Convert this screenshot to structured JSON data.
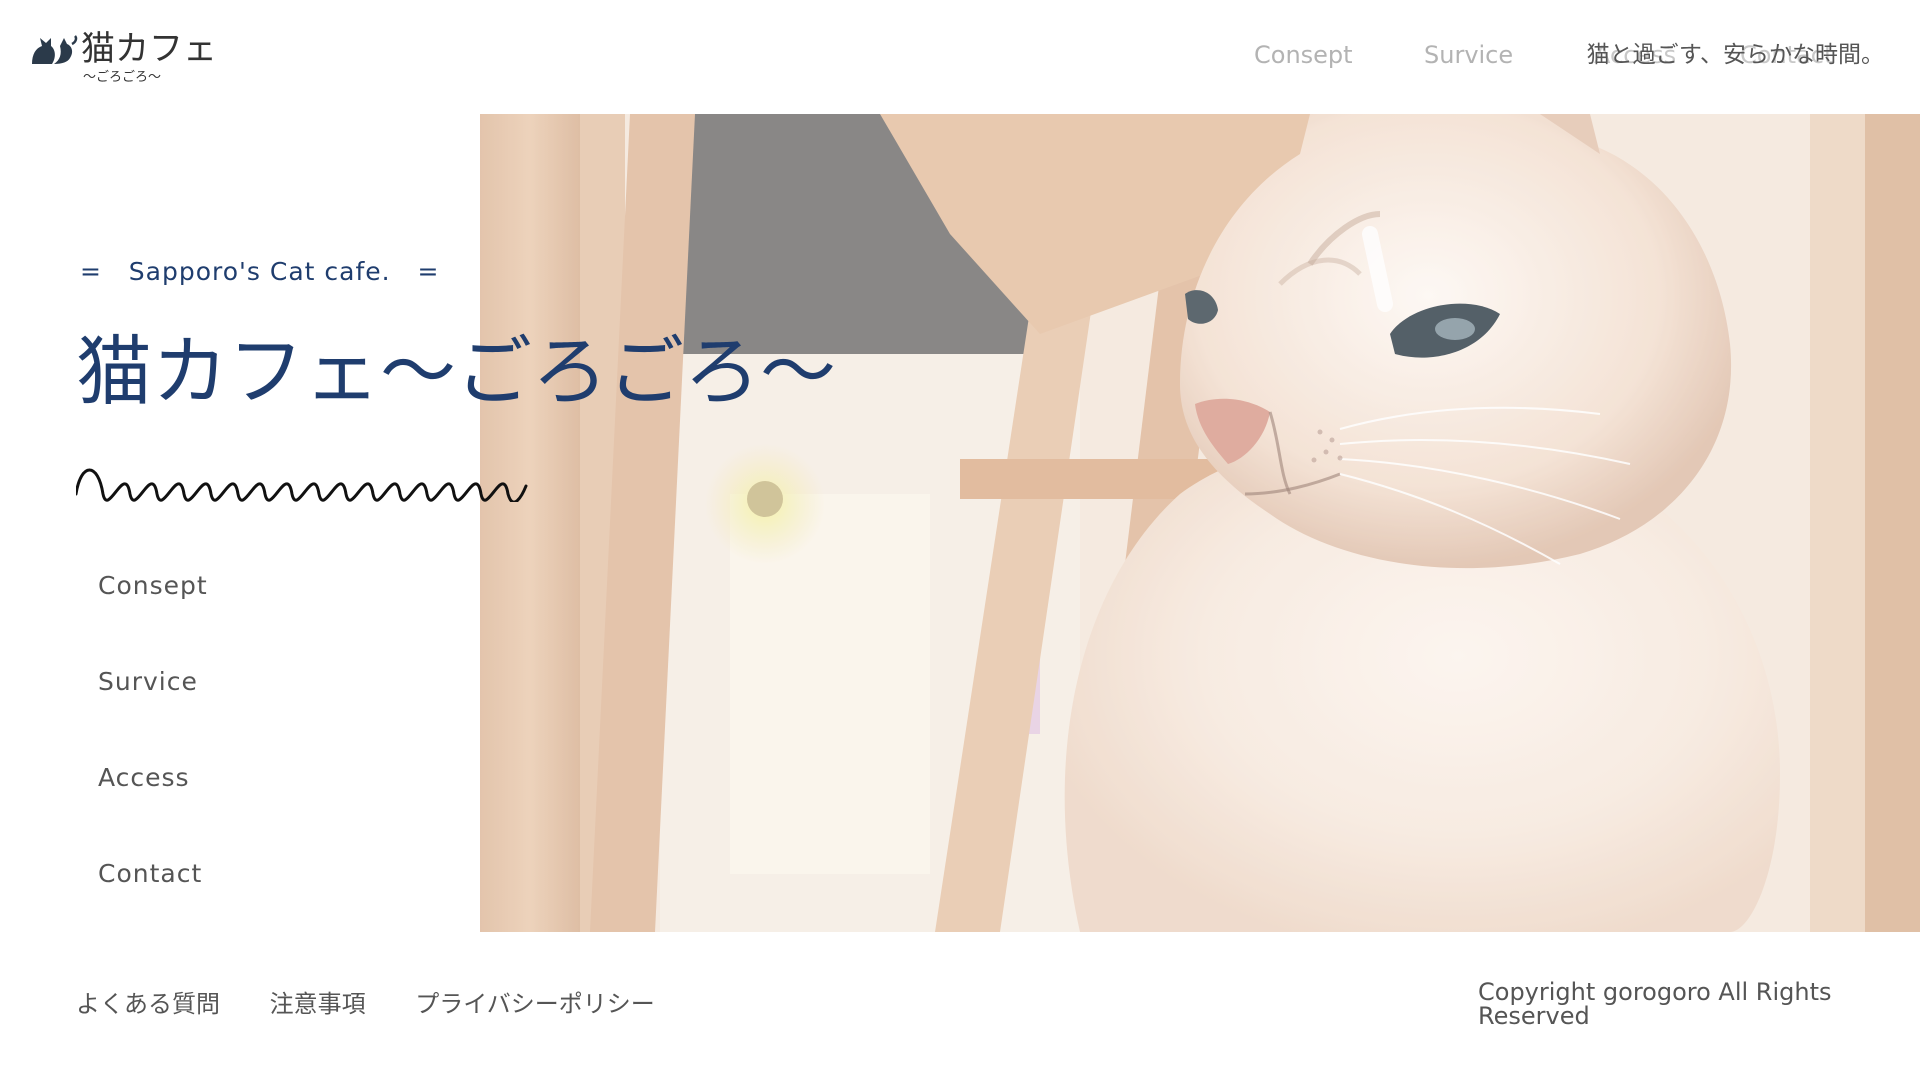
{
  "header": {
    "logo_title": "猫カフェ",
    "logo_sub": "〜ごろごろ〜",
    "nav": [
      {
        "label": "Consept"
      },
      {
        "label": "Survice"
      }
    ],
    "ghost_nav": [
      "Access",
      "Contact"
    ],
    "tagline": "猫と過ごす、安らかな時間。"
  },
  "hero": {
    "catch": "=   Sapporo's Cat cafe.   =",
    "title": "猫カフェ〜ごろごろ〜"
  },
  "side_nav": {
    "items": [
      {
        "label": "Consept"
      },
      {
        "label": "Survice"
      },
      {
        "label": "Access"
      },
      {
        "label": "Contact"
      }
    ]
  },
  "footer": {
    "links": [
      {
        "label": "よくある質問"
      },
      {
        "label": "注意事項"
      },
      {
        "label": "プライバシーポリシー"
      }
    ],
    "copyright": "Copyright gorogoro All Rights Reserved"
  },
  "colors": {
    "title_blue": "#1f3d6e",
    "nav_gray": "#b3b3b3",
    "text_gray": "#555555"
  }
}
